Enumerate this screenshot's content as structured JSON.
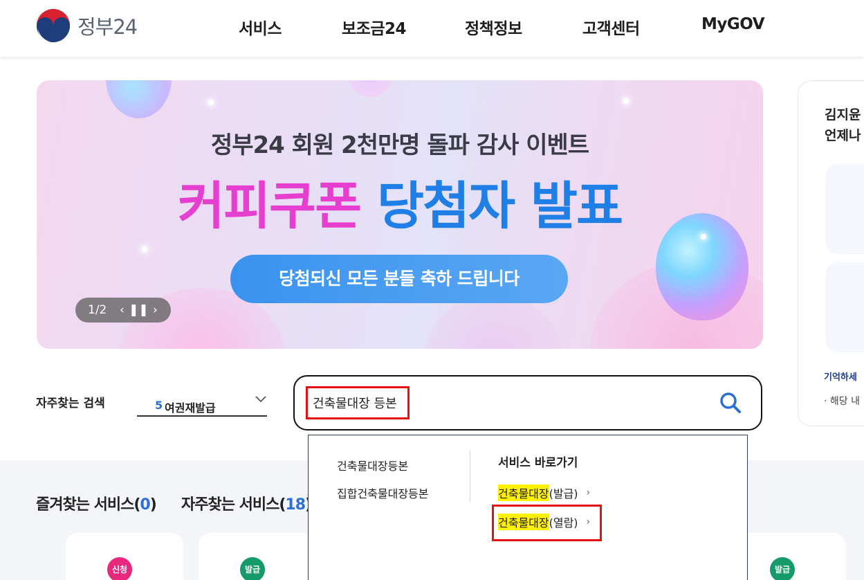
{
  "header": {
    "logo_text": "정부24",
    "nav": [
      "서비스",
      "보조금24",
      "정책정보",
      "고객센터",
      "MyGOV"
    ]
  },
  "banner": {
    "subtitle": "정부24 회원 2천만명 돌파 감사 이벤트",
    "title_pink": "커피쿠폰",
    "title_blue": "당첨자 발표",
    "cta": "당첨되신 모든 분들 축하 드립니다",
    "counter": "1/2"
  },
  "sidepanel": {
    "greeting_line1": "김지윤",
    "greeting_line2": "언제나",
    "remember": "기억하세",
    "note": "해당 내"
  },
  "search": {
    "fav_label": "자주찾는 검색",
    "fav_rank": "5",
    "fav_term": "여권재발급",
    "query": "건축물대장 등본"
  },
  "dropdown": {
    "suggestions": [
      "건축물대장등본",
      "집합건축물대장등본"
    ],
    "shortcut_title": "서비스 바로가기",
    "links": [
      {
        "highlight": "건축물대장",
        "suffix": "(발급)"
      },
      {
        "highlight": "건축물대장",
        "suffix": "(열람)"
      }
    ]
  },
  "tabs": {
    "favorites_label": "즐겨찾는 서비스",
    "favorites_count": "0",
    "frequent_label": "자주찾는 서비스",
    "frequent_count": "18"
  },
  "cards": {
    "badges": [
      "신청",
      "발급",
      "발급"
    ]
  },
  "colors": {
    "brand_blue": "#2c6fd8",
    "highlight_red": "#e8100f",
    "highlight_yellow": "#fff200",
    "badge_pink": "#e8287c",
    "badge_green": "#159a6a"
  }
}
